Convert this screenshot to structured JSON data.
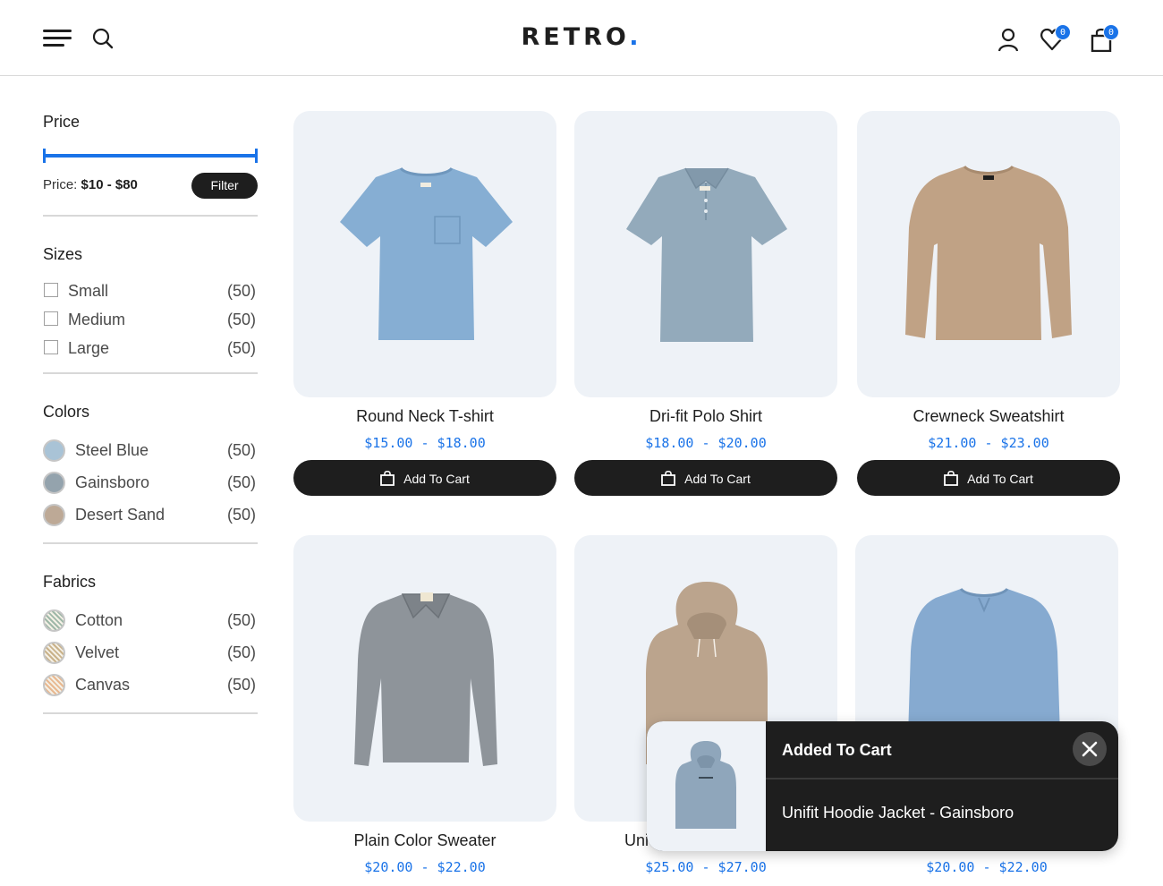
{
  "header": {
    "logo_text": "RETRO",
    "logo_dot": ".",
    "wishlist_count": "0",
    "cart_count": "0"
  },
  "filters": {
    "price": {
      "title": "Price",
      "label": "Price:",
      "range_text": "$10 - $80",
      "min_value": 10,
      "max_value": 80,
      "button": "Filter"
    },
    "sizes": {
      "title": "Sizes",
      "items": [
        {
          "label": "Small",
          "count": "(50)"
        },
        {
          "label": "Medium",
          "count": "(50)"
        },
        {
          "label": "Large",
          "count": "(50)"
        }
      ]
    },
    "colors": {
      "title": "Colors",
      "items": [
        {
          "label": "Steel Blue",
          "count": "(50)",
          "color": "#a9c3d6"
        },
        {
          "label": "Gainsboro",
          "count": "(50)",
          "color": "#94a3ad"
        },
        {
          "label": "Desert Sand",
          "count": "(50)",
          "color": "#bda996"
        }
      ]
    },
    "fabrics": {
      "title": "Fabrics",
      "items": [
        {
          "label": "Cotton",
          "count": "(50)",
          "color": "#9fb8a8"
        },
        {
          "label": "Velvet",
          "count": "(50)",
          "color": "#c9b28a"
        },
        {
          "label": "Canvas",
          "count": "(50)",
          "color": "#e8b890"
        }
      ]
    }
  },
  "products": [
    {
      "name": "Round Neck T-shirt",
      "price": "$15.00 - $18.00",
      "button": "Add To Cart",
      "icon": "tshirt-icon",
      "color": "#86aed3"
    },
    {
      "name": "Dri-fit Polo Shirt",
      "price": "$18.00 - $20.00",
      "button": "Add To Cart",
      "icon": "polo-shirt-icon",
      "color": "#93aabb"
    },
    {
      "name": "Crewneck Sweatshirt",
      "price": "$21.00 - $23.00",
      "button": "Add To Cart",
      "icon": "sweatshirt-icon",
      "color": "#c0a285"
    },
    {
      "name": "Plain Color Sweater",
      "price": "$20.00 - $22.00",
      "icon": "sweater-icon",
      "color": "#8e949a"
    },
    {
      "name": "Unifit Hoodie Jacket",
      "name_visible": "Uni",
      "price": "$25.00 - $27.00",
      "icon": "hoodie-icon",
      "color": "#bba48d"
    },
    {
      "name": "",
      "price": "$20.00 - $22.00",
      "icon": "sweatshirt-icon",
      "color": "#86aad0"
    }
  ],
  "toast": {
    "title": "Added To Cart",
    "message": "Unifit Hoodie Jacket - Gainsboro",
    "thumb_color": "#8fa6bb",
    "close_icon": "close-icon"
  },
  "colors": {
    "accent": "#1a73e8",
    "dark": "#1e1e1e",
    "card_bg": "#eef2f7"
  }
}
